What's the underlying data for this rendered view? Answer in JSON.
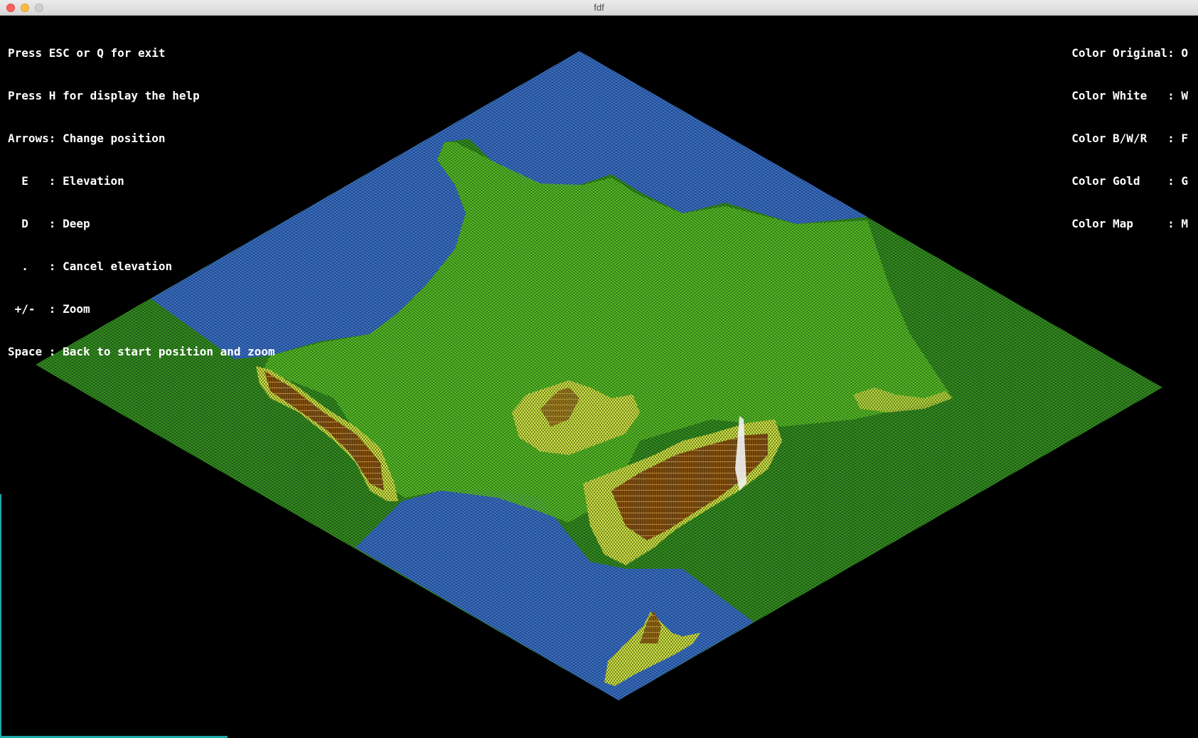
{
  "window": {
    "title": "fdf"
  },
  "help": {
    "lines": [
      "Press ESC or Q for exit",
      "Press H for display the help",
      "Arrows: Change position",
      "  E   : Elevation",
      "  D   : Deep",
      "  .   : Cancel elevation",
      " +/-  : Zoom",
      "Space : Back to start position and zoom"
    ]
  },
  "colors_menu": {
    "lines": [
      "Color Original: O",
      "Color White   : W",
      "Color B/W/R   : F",
      "Color Gold    : G",
      "Color Map     : M"
    ]
  },
  "palette": {
    "sea": "#2f5fa8",
    "land": "#2e8a1c",
    "land_bright": "#7ed321",
    "hills": "#e8e84a",
    "mountain": "#a3661c",
    "peak": "#ffffff"
  }
}
